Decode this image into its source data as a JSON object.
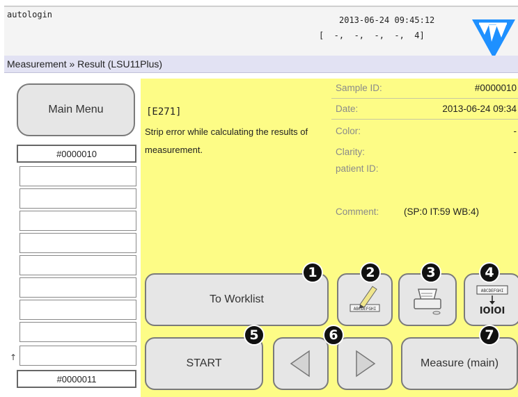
{
  "header": {
    "app_label": "autologin",
    "datetime": "2013-06-24 09:45:12",
    "status_line": "[  -,  -,  -,  -,  4]",
    "logo": "77-logo-icon"
  },
  "breadcrumb": "Measurement » Result (LSU11Plus)",
  "sidebar": {
    "main_menu_label": "Main Menu",
    "top_sample": "#0000010",
    "bottom_sample": "#0000011",
    "empty_rows": 9
  },
  "error": {
    "code": "[E271]",
    "message": "Strip error while calculating the results of measurement."
  },
  "info": {
    "sample_id_label": "Sample ID:",
    "sample_id_value": "#0000010",
    "date_label": "Date:",
    "date_value": "2013-06-24 09:34",
    "color_label": "Color:",
    "color_value": "-",
    "clarity_label": "Clarity:",
    "clarity_value": "-",
    "patient_label": "patient ID:",
    "comment_label": "Comment:",
    "comment_value": "(SP:0 IT:59 WB:4)"
  },
  "buttons": {
    "to_worklist": "To Worklist",
    "start": "START",
    "measure_main": "Measure (main)",
    "edit_icon": "edit-pencil-icon",
    "print_icon": "printer-icon",
    "export_label": "IOIOI",
    "export_top_label": "ABCDEFGHI",
    "edit_label": "ABCDEFGHI"
  },
  "badges": [
    "1",
    "2",
    "3",
    "4",
    "5",
    "6",
    "7"
  ],
  "colors": {
    "panel_background": "#fdfc86",
    "breadcrumb_background": "#e2e2f3",
    "logo_blue": "#1e90ff"
  }
}
